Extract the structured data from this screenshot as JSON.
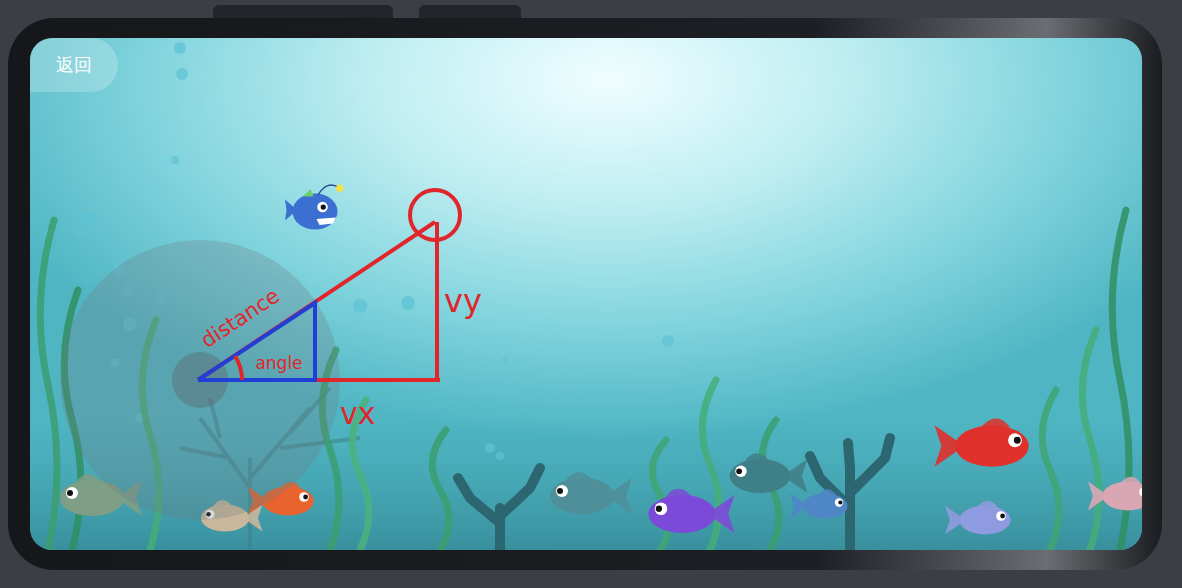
{
  "back_button": {
    "label": "返回"
  },
  "diagram": {
    "hypotenuse": "distance",
    "angle": "angle",
    "horizontal": "vx",
    "vertical": "vy"
  },
  "fish": [
    {
      "kind": "angler",
      "color": "#3b6fd1"
    },
    {
      "kind": "fish",
      "color": "#e0302c"
    },
    {
      "kind": "fish",
      "color": "#7e9e86"
    },
    {
      "kind": "fish",
      "color": "#e8632e"
    },
    {
      "kind": "fish",
      "color": "#c9b79c"
    },
    {
      "kind": "fish",
      "color": "#4f8f9a"
    },
    {
      "kind": "fish",
      "color": "#7c4ad8"
    },
    {
      "kind": "fish",
      "color": "#3f7f88"
    },
    {
      "kind": "fish",
      "color": "#4f86c6"
    },
    {
      "kind": "fish",
      "color": "#8f9be0"
    },
    {
      "kind": "fish",
      "color": "#d9a6b4"
    }
  ]
}
